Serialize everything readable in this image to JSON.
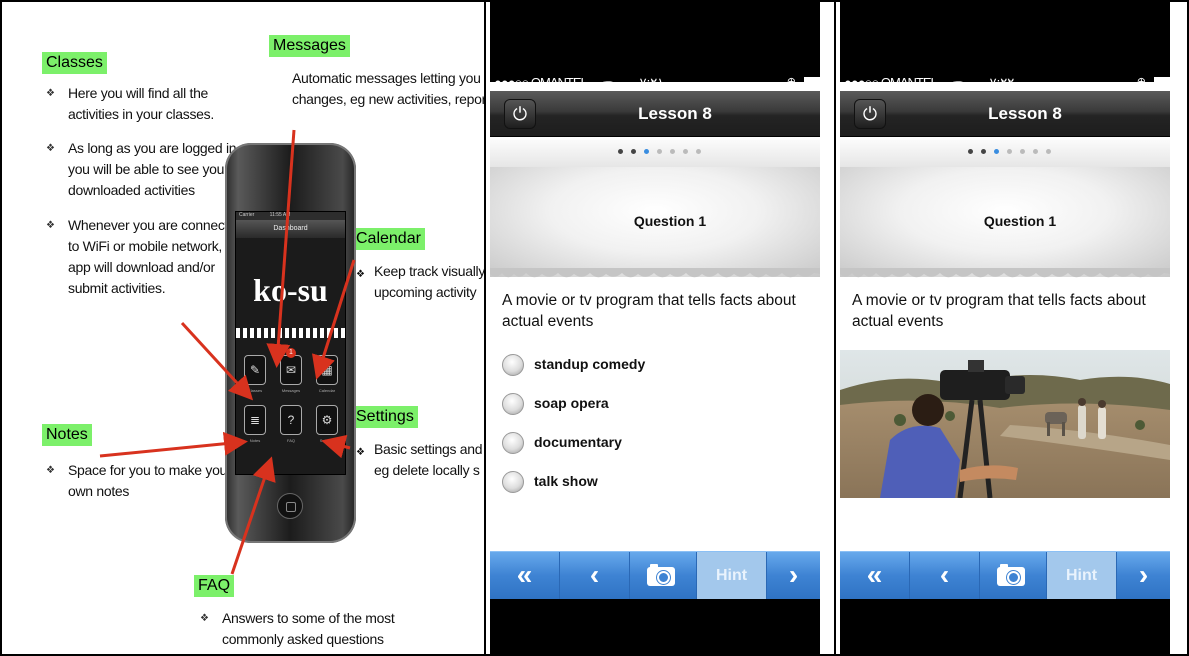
{
  "left": {
    "classes": {
      "heading": "Classes",
      "bullets": [
        [
          "Here you will find all the",
          "activities in your classes."
        ],
        [
          "As long as you are logged in,",
          "you will be able to see your",
          "downloaded activities"
        ],
        [
          "Whenever you are connected",
          "to WiFi or mobile network,",
          "app will download and/or",
          "submit activities."
        ]
      ]
    },
    "messages": {
      "heading": "Messages",
      "lines": [
        "Automatic messages letting you kn",
        "changes, eg new activities, reports,"
      ]
    },
    "calendar": {
      "heading": "Calendar",
      "lines": [
        "Keep track visually",
        "upcoming activity"
      ]
    },
    "settings": {
      "heading": "Settings",
      "lines": [
        "Basic settings and",
        "eg delete locally s"
      ]
    },
    "notes": {
      "heading": "Notes",
      "lines": [
        "Space for you to make your",
        "own notes"
      ]
    },
    "faq": {
      "heading": "FAQ",
      "lines": [
        "Answers to some of the most",
        "commonly asked questions"
      ]
    },
    "phone": {
      "carrier": "Carrier",
      "time": "11:55 AM",
      "header": "Dashboard",
      "logo": "ko-su",
      "tiles": [
        {
          "label": "Classes",
          "icon": "pencil-icon"
        },
        {
          "label": "Messages",
          "icon": "envelope-icon"
        },
        {
          "label": "Calendar",
          "icon": "calendar-icon"
        },
        {
          "label": "Notes",
          "icon": "notes-icon"
        },
        {
          "label": "FAQ",
          "icon": "question-icon"
        },
        {
          "label": "Settings",
          "icon": "gear-icon"
        }
      ],
      "badge": "1"
    },
    "arrow_color": "#d8321e",
    "highlight_color": "#7cf06a"
  },
  "phones": [
    {
      "carrier": "●●●○○ OMANTEL",
      "time": "٧:٢١ م",
      "title": "Lesson 8",
      "question_title": "Question 1",
      "question_text": "A movie or tv program that tells facts about actual events",
      "options": [
        "standup comedy",
        "soap opera",
        "documentary",
        "talk show"
      ],
      "toolbar": {
        "first": "«",
        "prev": "‹",
        "hint": "Hint",
        "next": "›"
      }
    },
    {
      "carrier": "●●●○○ OMANTEL",
      "time": "٧:٢٢ م",
      "title": "Lesson 8",
      "question_title": "Question 1",
      "question_text": "A movie or tv program that tells facts about actual events",
      "toolbar": {
        "first": "«",
        "prev": "‹",
        "hint": "Hint",
        "next": "›"
      }
    }
  ],
  "colors": {
    "toolbar_blue": "#3e83d3",
    "hint_bg": "#a3c8ec",
    "pager_selected": "#3a8de0"
  }
}
